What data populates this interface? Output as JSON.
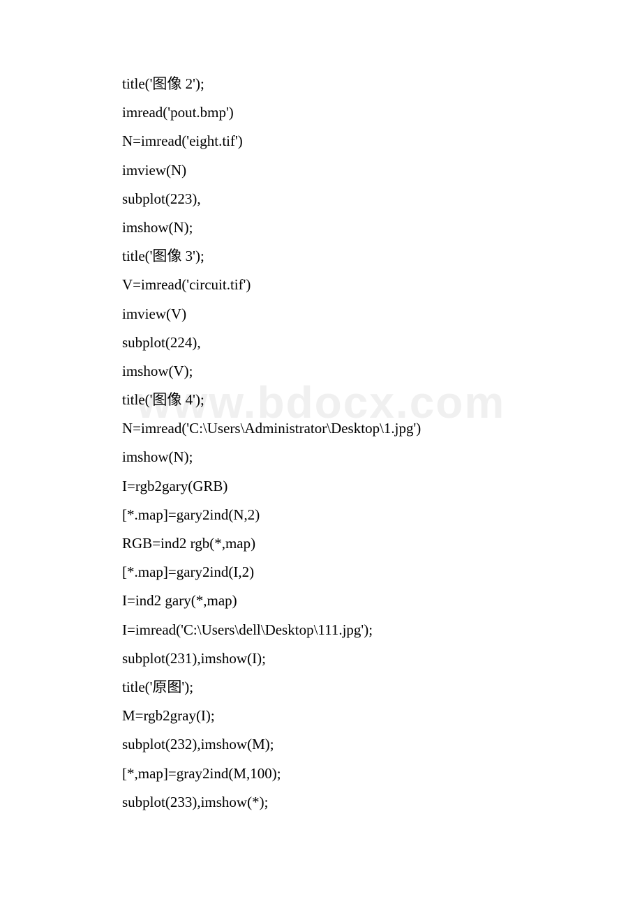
{
  "watermark": "www.bdocx.com",
  "lines": [
    "title('图像 2');",
    "imread('pout.bmp')",
    "N=imread('eight.tif')",
    "imview(N)",
    "subplot(223),",
    "imshow(N);",
    "title('图像 3');",
    "V=imread('circuit.tif')",
    "imview(V)",
    "subplot(224),",
    "imshow(V);",
    "title('图像 4');",
    "N=imread('C:\\Users\\Administrator\\Desktop\\1.jpg')",
    "imshow(N);",
    "I=rgb2gary(GRB)",
    "[*.map]=gary2ind(N,2)",
    "RGB=ind2 rgb(*,map)",
    "[*.map]=gary2ind(I,2)",
    "I=ind2 gary(*,map)",
    "I=imread('C:\\Users\\dell\\Desktop\\111.jpg');",
    "subplot(231),imshow(I);",
    "title('原图');",
    "M=rgb2gray(I);",
    "subplot(232),imshow(M);",
    "[*,map]=gray2ind(M,100);",
    "subplot(233),imshow(*);"
  ]
}
